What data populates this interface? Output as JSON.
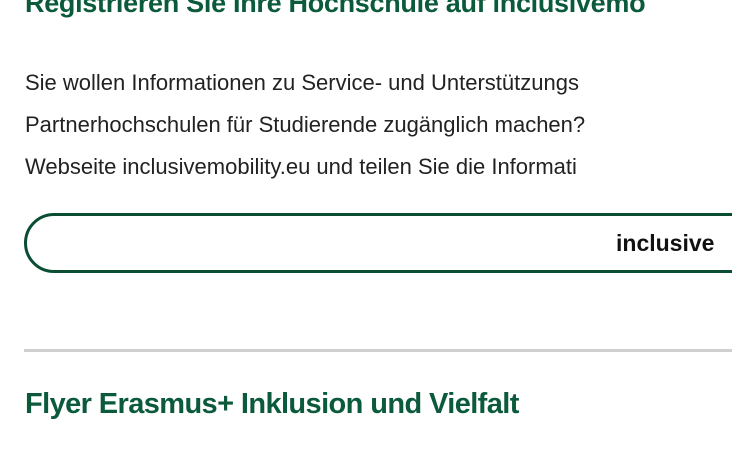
{
  "section_register": {
    "heading": "Registrieren Sie Ihre Hochschule auf inclusivemo",
    "intro_lines": [
      "Sie wollen Informationen zu Service- und Unterstützungs",
      "Partnerhochschulen für Studierende zugänglich machen?",
      "Webseite inclusivemobility.eu und teilen Sie die Informati"
    ],
    "link_button_label": "inclusive"
  },
  "section_flyer": {
    "heading": "Flyer Erasmus+ Inklusion und Vielfalt"
  },
  "colors": {
    "heading_green": "#0b5a3c",
    "button_border": "#0b4d32",
    "divider": "#cfcfcf",
    "body_text": "#222222"
  }
}
